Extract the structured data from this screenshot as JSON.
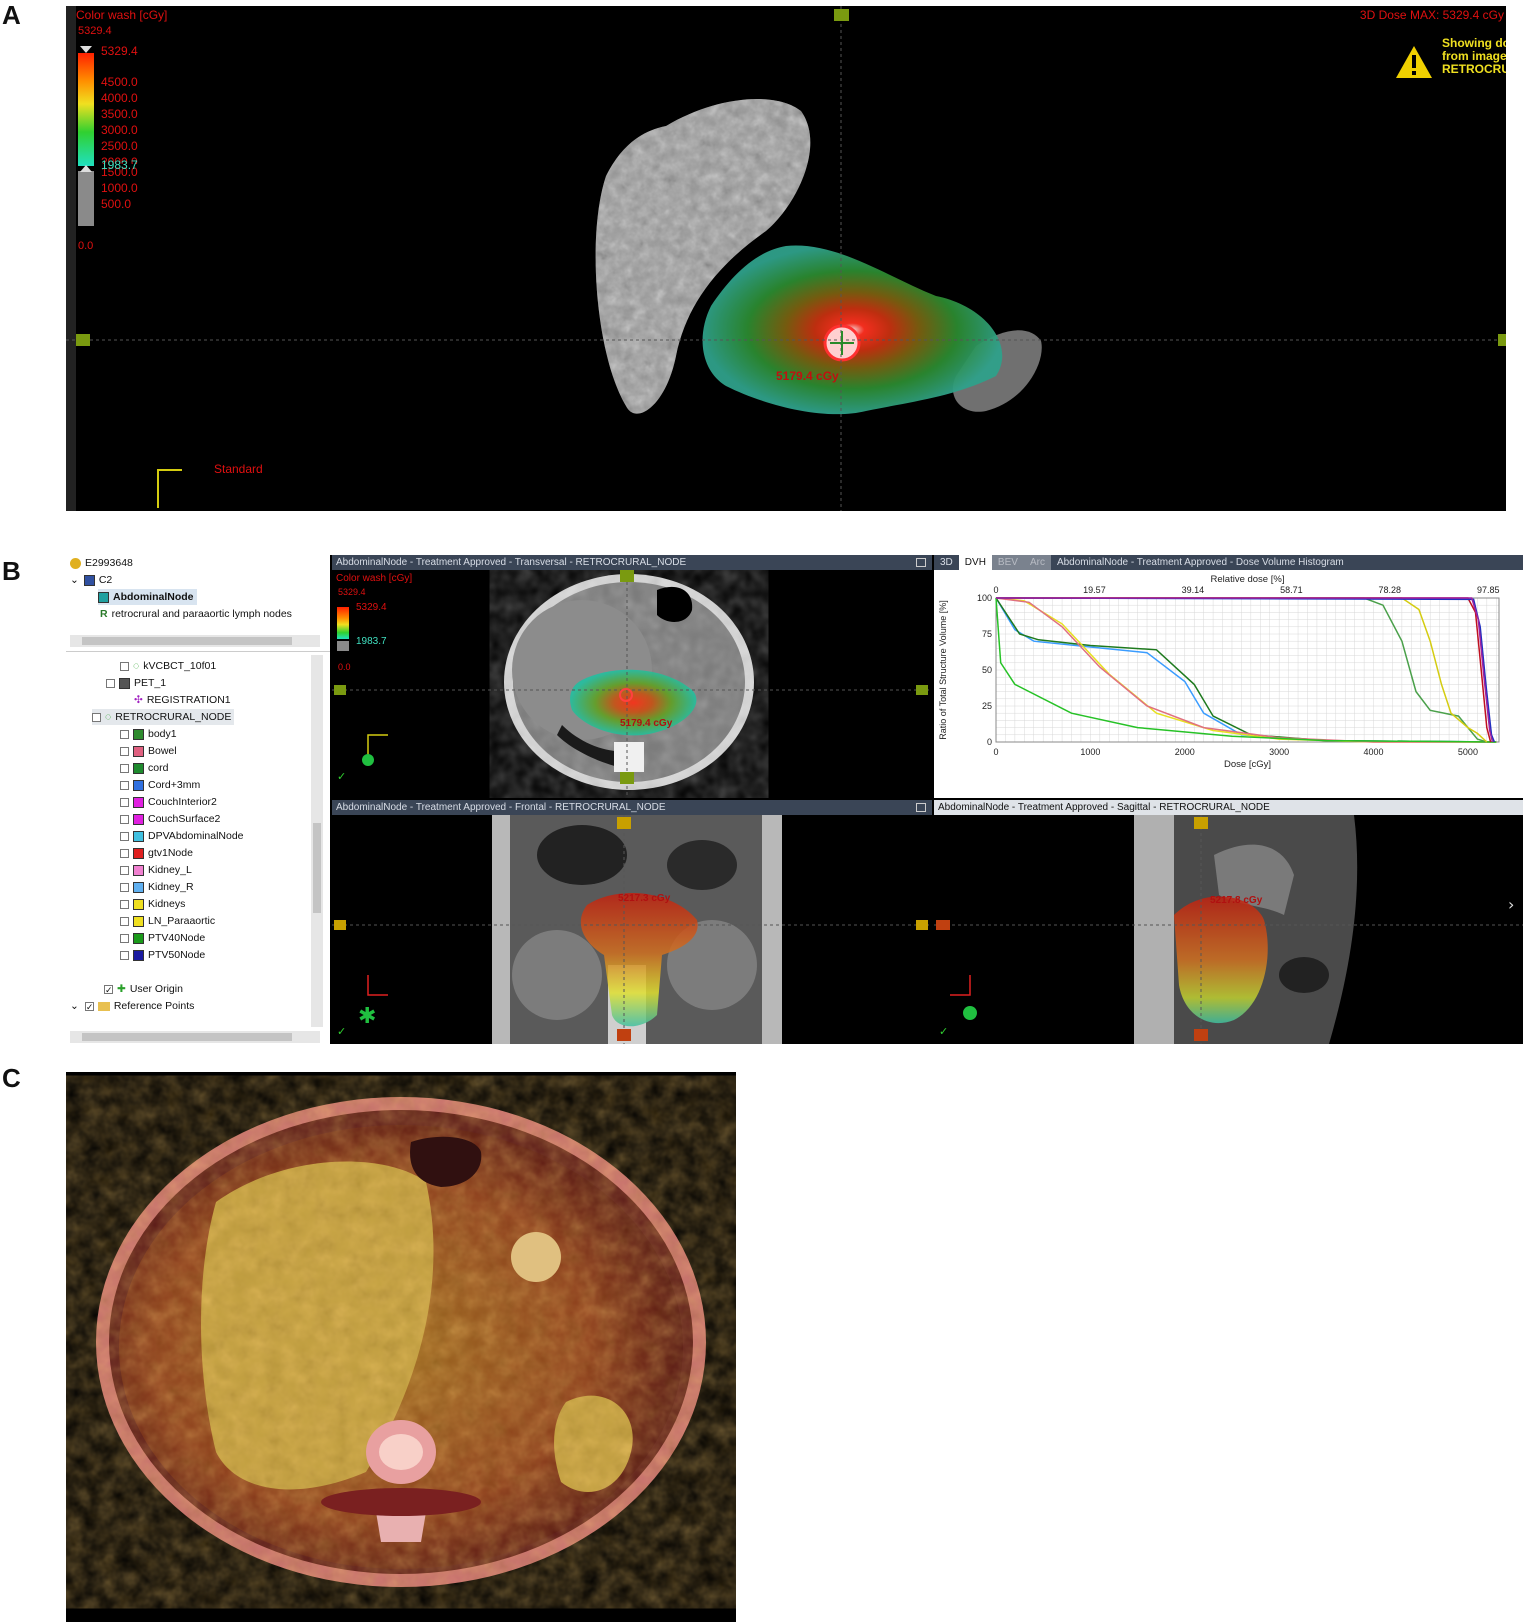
{
  "panel_labels": {
    "a": "A",
    "b": "B",
    "c": "C"
  },
  "panel_a": {
    "colorwash_title": "Color wash [cGy]",
    "max_value": "5329.4",
    "top_value": "5329.4",
    "scale_labels": [
      "4500.0",
      "4000.0",
      "3500.0",
      "3000.0",
      "2500.0",
      "2000.0",
      "1500.0",
      "1000.0",
      "500.0"
    ],
    "threshold_value": "1983.7",
    "min_value": "0.0",
    "dose_max_label": "3D Dose MAX: 5329.4 cGy",
    "warning_lines": [
      "Showing dose",
      "from image",
      "RETROCRURAL_NODE"
    ],
    "point_dose": "5179.4 cGy",
    "orientation_label": "Standard"
  },
  "panel_b": {
    "tree": {
      "patient_id": "E2993648",
      "course": "C2",
      "plan": "AbdominalNode",
      "rx": "retrocrural and paraaortic lymph nodes",
      "images": [
        "kVCBCT_10f01",
        "PET_1",
        "REGISTRATION1",
        "RETROCRURAL_NODE"
      ],
      "structures": [
        "body1",
        "Bowel",
        "cord",
        "Cord+3mm",
        "CouchInterior2",
        "CouchSurface2",
        "DPVAbdominalNode",
        "gtv1Node",
        "Kidney_L",
        "Kidney_R",
        "Kidneys",
        "LN_Paraaortic",
        "PTV40Node",
        "PTV50Node"
      ],
      "structure_colors": [
        "#2e8b2e",
        "#e06080",
        "#1e8a2e",
        "#3070e0",
        "#e020e0",
        "#e020e0",
        "#40c0e0",
        "#e02020",
        "#f080d0",
        "#60b0f0",
        "#f0e020",
        "#f0e020",
        "#1a9a1a",
        "#1a1aa0"
      ],
      "user_origin": "User Origin",
      "reference_points": "Reference Points"
    },
    "transversal": {
      "header": "AbdominalNode  -  Treatment Approved - Transversal - RETROCRURAL_NODE",
      "colorwash_title": "Color wash [cGy]",
      "max_value": "5329.4",
      "top_value": "5329.4",
      "threshold_value": "1983.7",
      "min_value": "0.0",
      "point_dose": "5179.4 cGy"
    },
    "frontal": {
      "header": "AbdominalNode  -  Treatment Approved - Frontal - RETROCRURAL_NODE",
      "point_dose": "5217.3 cGy"
    },
    "sagittal": {
      "header": "AbdominalNode  -  Treatment Approved - Sagittal - RETROCRURAL_NODE",
      "point_dose": "5217.8 cGy"
    },
    "dvh_tabs": [
      "3D",
      "DVH",
      "BEV",
      "Arc"
    ],
    "dvh_header": "AbdominalNode  -  Treatment Approved - Dose Volume Histogram"
  },
  "chart_data": {
    "type": "line",
    "title": "",
    "xlabel": "Dose [cGy]",
    "ylabel": "Ratio of Total Structure Volume [%]",
    "x2label": "Relative dose [%]",
    "xlim": [
      0,
      5329
    ],
    "ylim": [
      0,
      100
    ],
    "x_ticks": [
      0,
      1000,
      2000,
      3000,
      4000,
      5000
    ],
    "y_ticks": [
      0,
      25,
      50,
      75,
      100
    ],
    "x2_ticks": [
      "0",
      "19.57",
      "39.14",
      "58.71",
      "78.28",
      "97.85"
    ],
    "grid": true,
    "series": [
      {
        "color": "#3a9cff",
        "points": [
          [
            0,
            100
          ],
          [
            200,
            78
          ],
          [
            400,
            70
          ],
          [
            1000,
            66
          ],
          [
            1600,
            62
          ],
          [
            2000,
            42
          ],
          [
            2200,
            20
          ],
          [
            2600,
            5
          ],
          [
            3500,
            1
          ],
          [
            5300,
            0
          ]
        ]
      },
      {
        "color": "#1e7a1e",
        "points": [
          [
            0,
            100
          ],
          [
            250,
            75
          ],
          [
            450,
            71
          ],
          [
            1000,
            67
          ],
          [
            1700,
            64
          ],
          [
            2100,
            40
          ],
          [
            2300,
            18
          ],
          [
            2700,
            5
          ],
          [
            3500,
            1
          ],
          [
            5300,
            0
          ]
        ]
      },
      {
        "color": "#e8e020",
        "points": [
          [
            0,
            100
          ],
          [
            300,
            98
          ],
          [
            700,
            82
          ],
          [
            1200,
            47
          ],
          [
            1700,
            20
          ],
          [
            2300,
            8
          ],
          [
            3000,
            2
          ],
          [
            4000,
            0
          ],
          [
            5300,
            0
          ]
        ]
      },
      {
        "color": "#e07080",
        "points": [
          [
            0,
            100
          ],
          [
            350,
            97
          ],
          [
            700,
            80
          ],
          [
            1100,
            52
          ],
          [
            1600,
            25
          ],
          [
            2200,
            10
          ],
          [
            3000,
            3
          ],
          [
            4000,
            0
          ],
          [
            5300,
            0
          ]
        ]
      },
      {
        "color": "#26c226",
        "points": [
          [
            0,
            100
          ],
          [
            50,
            55
          ],
          [
            200,
            40
          ],
          [
            800,
            20
          ],
          [
            1500,
            10
          ],
          [
            2500,
            4
          ],
          [
            3500,
            1
          ],
          [
            5300,
            0
          ]
        ]
      },
      {
        "color": "#4aa04a",
        "points": [
          [
            0,
            100
          ],
          [
            3900,
            100
          ],
          [
            4100,
            95
          ],
          [
            4300,
            70
          ],
          [
            4450,
            35
          ],
          [
            4600,
            22
          ],
          [
            4900,
            18
          ],
          [
            5000,
            10
          ],
          [
            5100,
            2
          ],
          [
            5200,
            0
          ]
        ]
      },
      {
        "color": "#d4cc10",
        "points": [
          [
            0,
            100
          ],
          [
            4300,
            100
          ],
          [
            4480,
            92
          ],
          [
            4600,
            70
          ],
          [
            4720,
            40
          ],
          [
            4820,
            20
          ],
          [
            5000,
            10
          ],
          [
            5100,
            6
          ],
          [
            5200,
            0
          ]
        ]
      },
      {
        "color": "#c01020",
        "points": [
          [
            0,
            100
          ],
          [
            5000,
            100
          ],
          [
            5080,
            90
          ],
          [
            5140,
            50
          ],
          [
            5200,
            10
          ],
          [
            5240,
            0
          ]
        ]
      },
      {
        "color": "#2030c0",
        "points": [
          [
            0,
            100
          ],
          [
            5060,
            99
          ],
          [
            5130,
            80
          ],
          [
            5190,
            40
          ],
          [
            5250,
            5
          ],
          [
            5280,
            0
          ]
        ]
      },
      {
        "color": "#a020a0",
        "points": [
          [
            0,
            100
          ],
          [
            5040,
            100
          ],
          [
            5110,
            85
          ],
          [
            5170,
            45
          ],
          [
            5230,
            8
          ],
          [
            5260,
            0
          ]
        ]
      }
    ]
  },
  "panel_c": {}
}
